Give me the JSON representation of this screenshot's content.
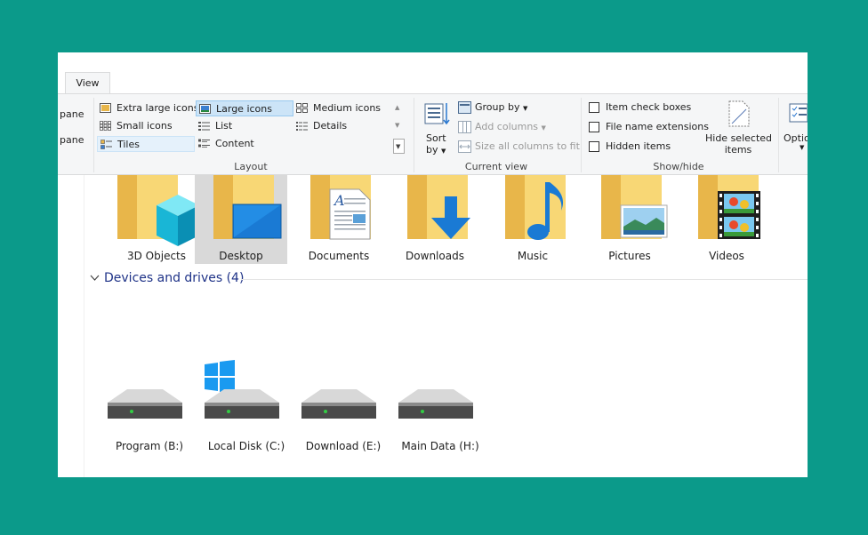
{
  "tabs": {
    "view": "View"
  },
  "ribbon": {
    "pane": {
      "label_top": "pane",
      "label_bottom": "pane"
    },
    "layout": {
      "group_label": "Layout",
      "items": {
        "extra_large": "Extra large icons",
        "large": "Large icons",
        "medium": "Medium icons",
        "small": "Small icons",
        "list": "List",
        "details": "Details",
        "tiles": "Tiles",
        "content": "Content"
      },
      "selected": "large"
    },
    "current_view": {
      "group_label": "Current view",
      "sort_by": "Sort",
      "sort_by2": "by",
      "group_by": "Group by",
      "add_columns": "Add columns",
      "size_columns": "Size all columns to fit"
    },
    "show_hide": {
      "group_label": "Show/hide",
      "item_check_boxes": "Item check boxes",
      "file_name_extensions": "File name extensions",
      "hidden_items": "Hidden items",
      "hide_selected_line1": "Hide selected",
      "hide_selected_line2": "items"
    },
    "options": {
      "label": "Optio"
    }
  },
  "folders": [
    {
      "label": "3D Objects",
      "icon": "3d-objects-icon"
    },
    {
      "label": "Desktop",
      "icon": "desktop-icon"
    },
    {
      "label": "Documents",
      "icon": "documents-icon"
    },
    {
      "label": "Downloads",
      "icon": "downloads-icon"
    },
    {
      "label": "Music",
      "icon": "music-icon"
    },
    {
      "label": "Pictures",
      "icon": "pictures-icon"
    },
    {
      "label": "Videos",
      "icon": "videos-icon"
    }
  ],
  "devices": {
    "header": "Devices and drives (4)",
    "drives": [
      {
        "label": "Program (B:)"
      },
      {
        "label": "Local Disk (C:)"
      },
      {
        "label": "Download (E:)"
      },
      {
        "label": "Main Data (H:)"
      }
    ]
  },
  "colors": {
    "frame": "#0b9a8a",
    "accent": "#1e3287",
    "selected": "#cce4f7"
  }
}
